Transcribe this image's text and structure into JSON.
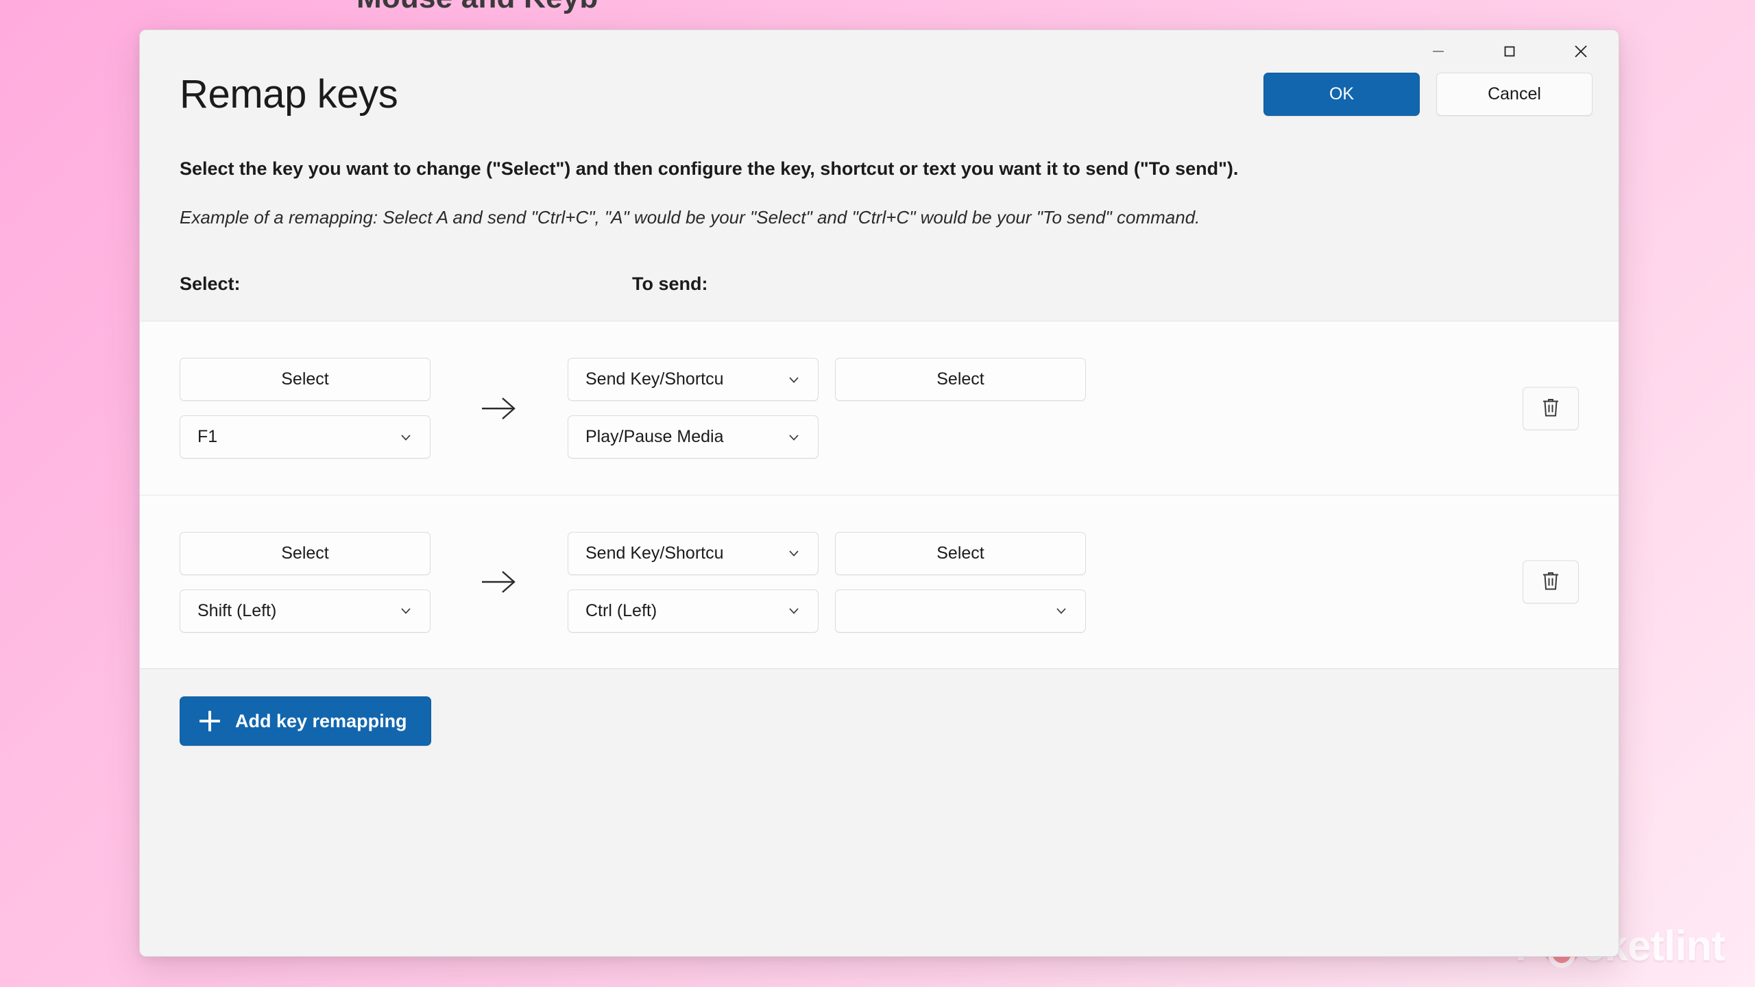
{
  "background": {
    "clipped_text": "Mouse and Keyb",
    "gradient_from": "#ffabdd",
    "gradient_to": "#ffeaf5"
  },
  "watermark": {
    "text_before": "P",
    "text_after": "cketlint",
    "power_icon_color": "#f2777f"
  },
  "window": {
    "controls": {
      "minimize": "minimize-icon",
      "maximize": "maximize-icon",
      "close": "close-icon"
    }
  },
  "header": {
    "title": "Remap keys",
    "ok_label": "OK",
    "cancel_label": "Cancel",
    "accent_color": "#1266ae"
  },
  "description": {
    "main": "Select the key you want to change (\"Select\") and then configure the key, shortcut or text you want it to send (\"To send\").",
    "example": "Example of a remapping: Select A and send \"Ctrl+C\", \"A\" would be your \"Select\" and \"Ctrl+C\" would be your \"To send\" command."
  },
  "columns": {
    "select_label": "Select:",
    "to_send_label": "To send:"
  },
  "rows": [
    {
      "select_button": "Select",
      "select_key": "F1",
      "arrow": "→",
      "send_type": "Send Key/Shortcu",
      "send_select_button": "Select",
      "send_key": "Play/Pause Media",
      "send_key_second": "",
      "has_second_field": false,
      "delete_icon": "trash-icon"
    },
    {
      "select_button": "Select",
      "select_key": "Shift (Left)",
      "arrow": "→",
      "send_type": "Send Key/Shortcu",
      "send_select_button": "Select",
      "send_key": "Ctrl (Left)",
      "send_key_second": "",
      "has_second_field": true,
      "delete_icon": "trash-icon"
    }
  ],
  "footer": {
    "add_label": "Add key remapping"
  }
}
